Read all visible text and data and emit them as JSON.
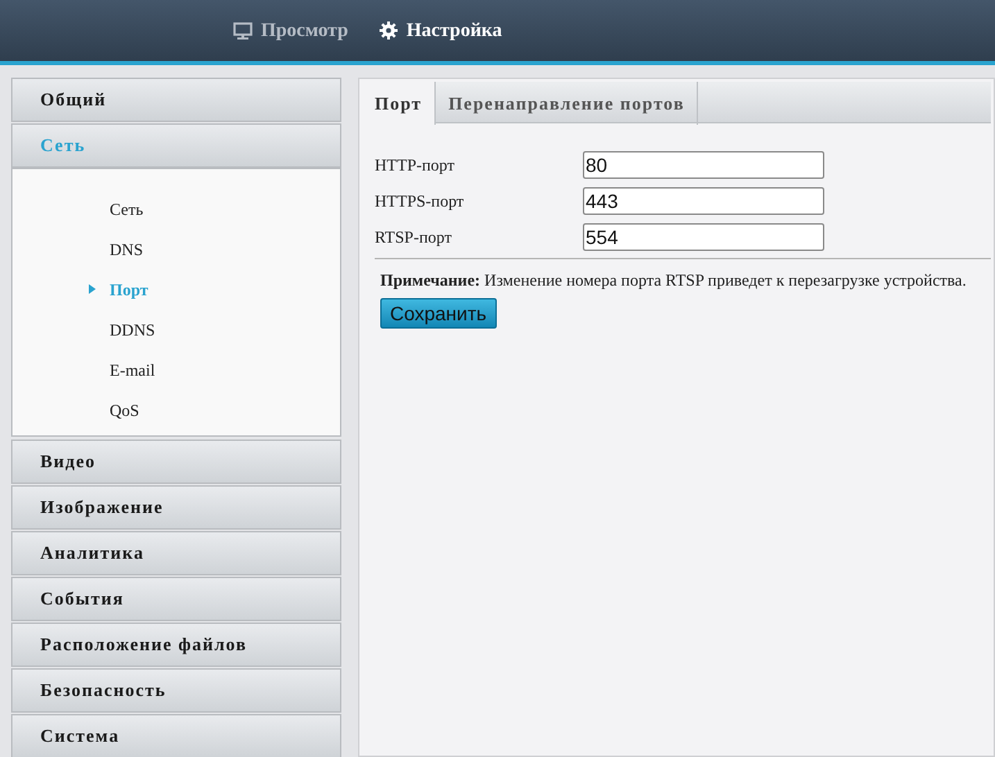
{
  "top_nav": [
    {
      "label": "Просмотр",
      "selected": false
    },
    {
      "label": "Настройка",
      "selected": true
    }
  ],
  "sidebar": {
    "sections": [
      {
        "label": "Общий",
        "selected": false
      },
      {
        "label": "Сеть",
        "selected": true,
        "children": [
          {
            "label": "Сеть",
            "selected": false
          },
          {
            "label": "DNS",
            "selected": false
          },
          {
            "label": "Порт",
            "selected": true
          },
          {
            "label": "DDNS",
            "selected": false
          },
          {
            "label": "E-mail",
            "selected": false
          },
          {
            "label": "QoS",
            "selected": false
          }
        ]
      },
      {
        "label": "Видео",
        "selected": false
      },
      {
        "label": "Изображение",
        "selected": false
      },
      {
        "label": "Аналитика",
        "selected": false
      },
      {
        "label": "События",
        "selected": false
      },
      {
        "label": "Расположение файлов",
        "selected": false
      },
      {
        "label": "Безопасность",
        "selected": false
      },
      {
        "label": "Система",
        "selected": false
      }
    ]
  },
  "tabs": [
    {
      "label": "Порт",
      "selected": true
    },
    {
      "label": "Перенаправление портов",
      "selected": false
    }
  ],
  "fields": [
    {
      "label": "HTTP-порт",
      "value": "80"
    },
    {
      "label": "HTTPS-порт",
      "value": "443"
    },
    {
      "label": "RTSP-порт",
      "value": "554"
    }
  ],
  "note": "**Примечание:** Изменение номера порта RTSP приведет к перезагрузке устройства.",
  "save_button": "Сохранить"
}
